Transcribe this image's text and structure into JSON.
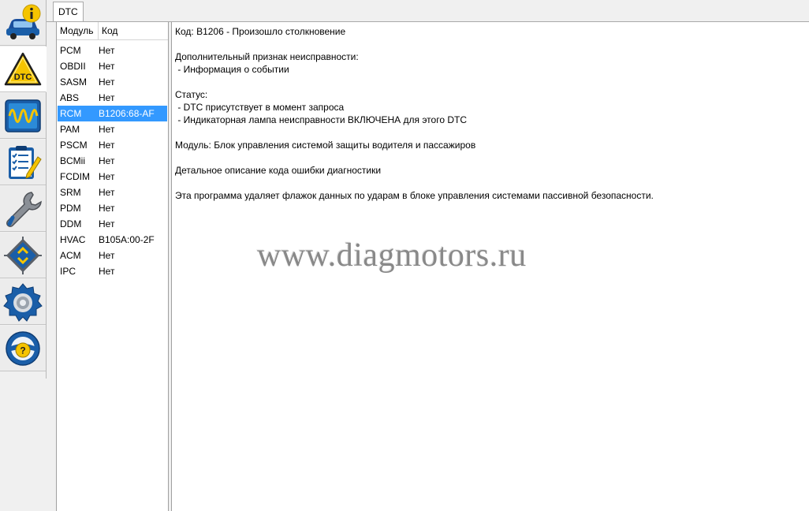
{
  "toolbar": {
    "items": [
      {
        "icon": "vehicle-info-icon",
        "active": false
      },
      {
        "icon": "dtc-warning-icon",
        "active": true,
        "badge_text": "DTC"
      },
      {
        "icon": "oscilloscope-icon",
        "active": false
      },
      {
        "icon": "checklist-icon",
        "active": false
      },
      {
        "icon": "wrench-icon",
        "active": false
      },
      {
        "icon": "module-programming-icon",
        "active": false
      },
      {
        "icon": "settings-gear-icon",
        "active": false
      },
      {
        "icon": "help-steering-wheel-icon",
        "active": false
      }
    ]
  },
  "tab": {
    "label": "DTC"
  },
  "list": {
    "headers": {
      "module": "Модуль",
      "code": "Код"
    },
    "rows": [
      {
        "module": "PCM",
        "code": "Нет",
        "selected": false
      },
      {
        "module": "OBDII",
        "code": "Нет",
        "selected": false
      },
      {
        "module": "SASM",
        "code": "Нет",
        "selected": false
      },
      {
        "module": "ABS",
        "code": "Нет",
        "selected": false
      },
      {
        "module": "RCM",
        "code": "B1206:68-AF",
        "selected": true
      },
      {
        "module": "PAM",
        "code": "Нет",
        "selected": false
      },
      {
        "module": "PSCM",
        "code": "Нет",
        "selected": false
      },
      {
        "module": "BCMii",
        "code": "Нет",
        "selected": false
      },
      {
        "module": "FCDIM",
        "code": "Нет",
        "selected": false
      },
      {
        "module": "SRM",
        "code": "Нет",
        "selected": false
      },
      {
        "module": "PDM",
        "code": "Нет",
        "selected": false
      },
      {
        "module": "DDM",
        "code": "Нет",
        "selected": false
      },
      {
        "module": "HVAC",
        "code": "B105A:00-2F",
        "selected": false
      },
      {
        "module": "ACM",
        "code": "Нет",
        "selected": false
      },
      {
        "module": "IPC",
        "code": "Нет",
        "selected": false
      }
    ]
  },
  "detail": {
    "code_line": "Код: B1206 - Произошло столкновение",
    "extra_title": "Дополнительный признак неисправности:",
    "extra_item": " - Информация о событии",
    "status_title": "Статус:",
    "status_1": " - DTC присутствует в момент запроса",
    "status_2": " - Индикаторная лампа неисправности ВКЛЮЧЕНА для этого DTC",
    "module_line": "Модуль: Блок управления системой защиты водителя и пассажиров",
    "desc_title": "Детальное описание кода ошибки диагностики",
    "desc_text": "Эта программа удаляет флажок данных по ударам в блоке управления системами пассивной безопасности."
  },
  "watermark": "www.diagmotors.ru",
  "colors": {
    "selection": "#3399ff",
    "accent_blue": "#1a5ea8",
    "warning_yellow": "#f5c400"
  }
}
